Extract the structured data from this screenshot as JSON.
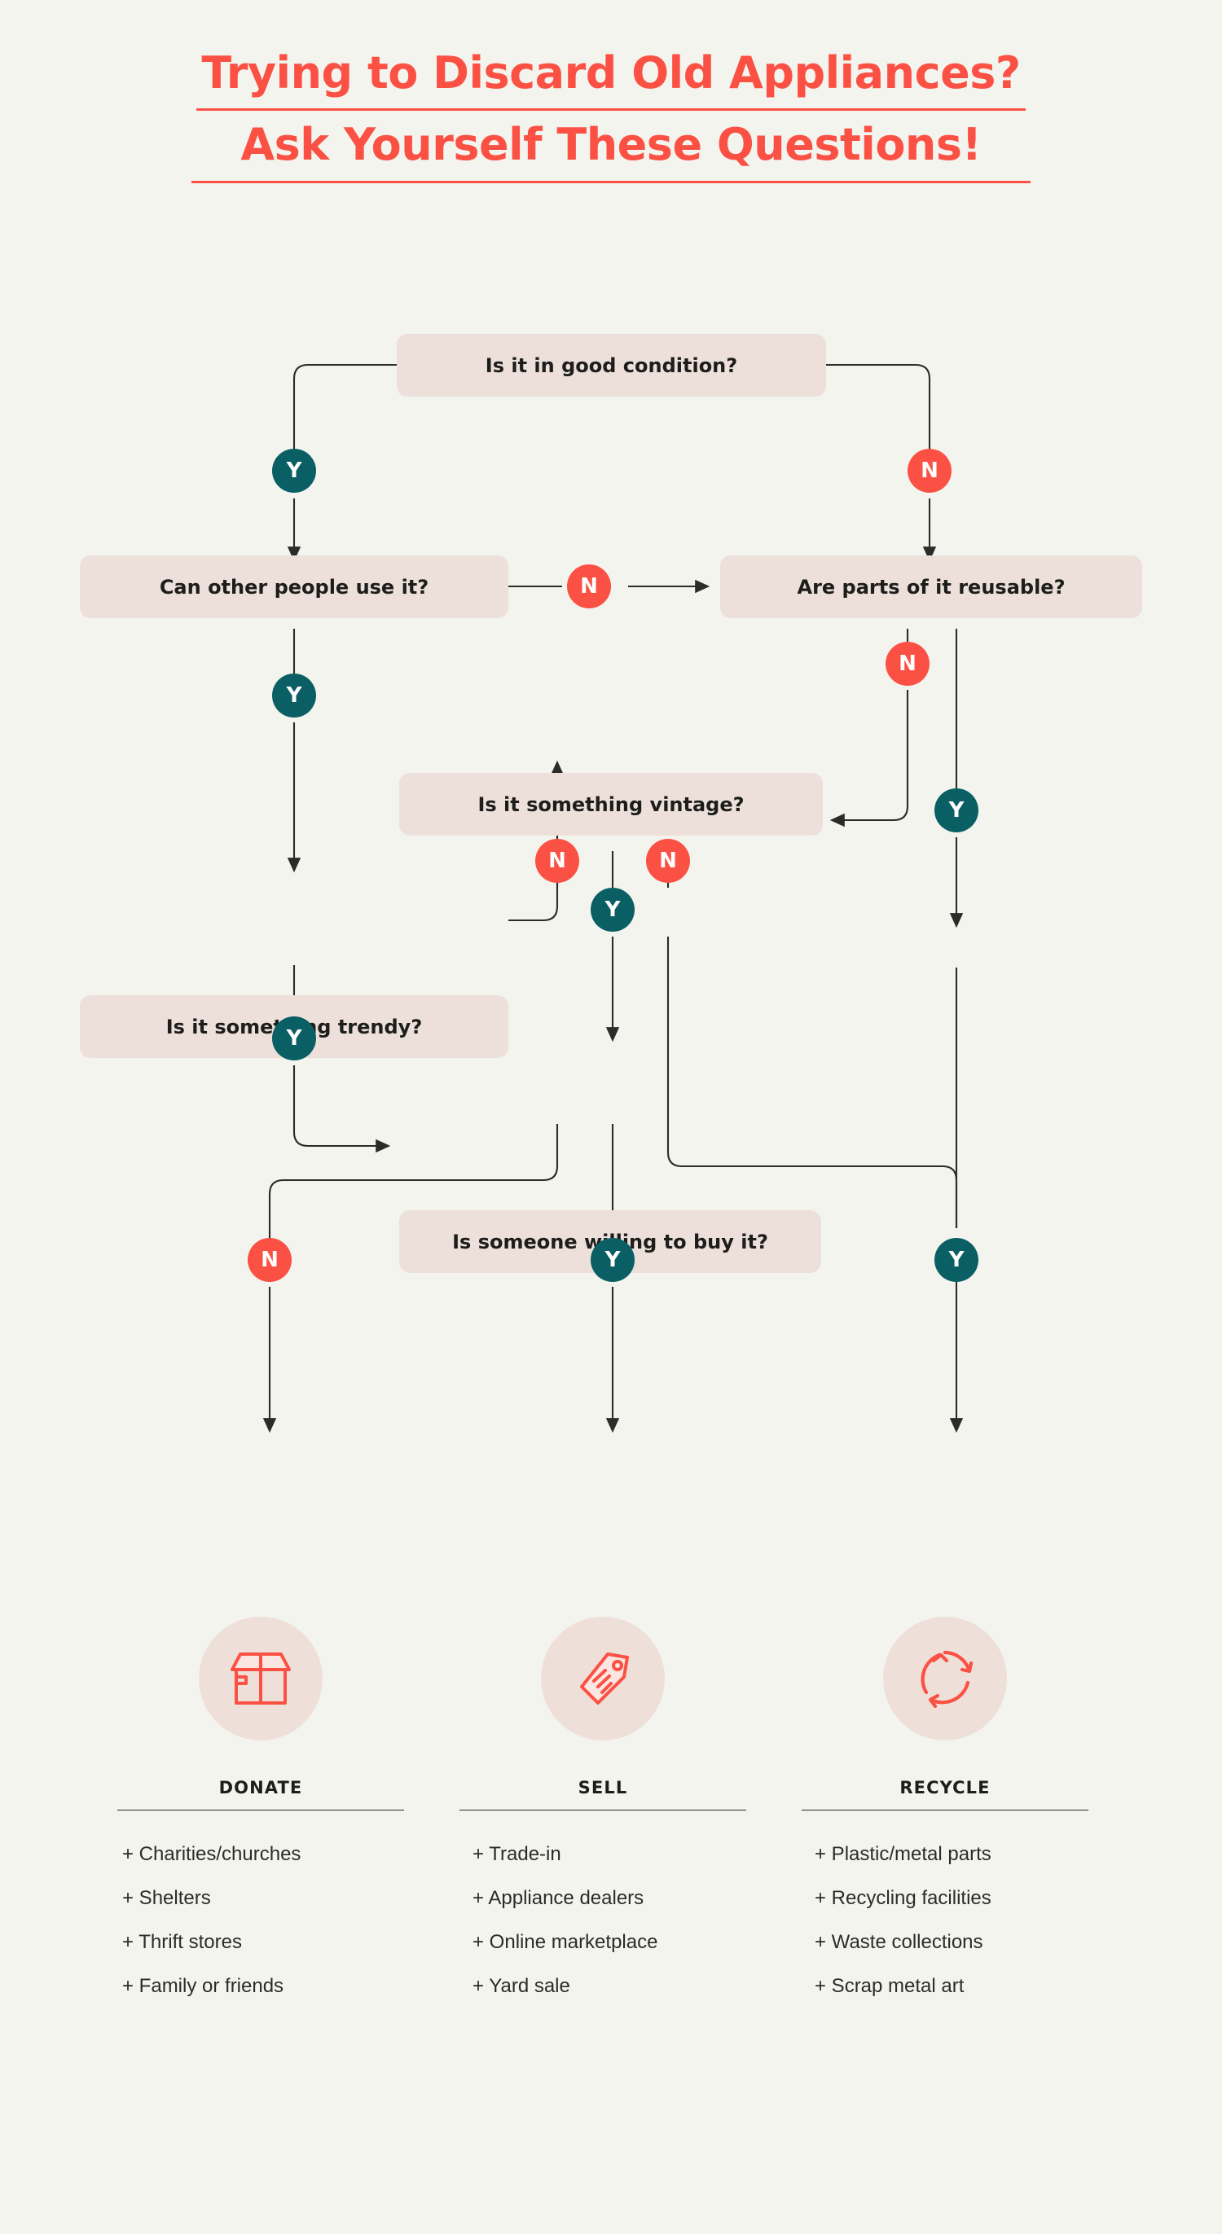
{
  "header": {
    "title_line1": "Trying to Discard Old Appliances?",
    "title_line2": "Ask Yourself These Questions!"
  },
  "colors": {
    "background": "#f4f4ef",
    "accent_red": "#fb5144",
    "accent_teal": "#0a5f64",
    "node_fill": "#ede0da",
    "line": "#2b2b29",
    "text": "#1d1d1b"
  },
  "flowchart": {
    "nodes": [
      {
        "id": "condition",
        "label": "Is it in good condition?"
      },
      {
        "id": "others-use",
        "label": "Can other people use it?"
      },
      {
        "id": "parts-reusable",
        "label": "Are parts of it reusable?"
      },
      {
        "id": "vintage",
        "label": "Is it something vintage?"
      },
      {
        "id": "trendy",
        "label": "Is it something trendy?"
      },
      {
        "id": "willing-buy",
        "label": "Is someone willing to buy it?"
      }
    ],
    "badges": [
      {
        "id": "b1",
        "value": "Y",
        "type": "yes"
      },
      {
        "id": "b2",
        "value": "N",
        "type": "no"
      },
      {
        "id": "b3",
        "value": "N",
        "type": "no"
      },
      {
        "id": "b4",
        "value": "N",
        "type": "no"
      },
      {
        "id": "b5",
        "value": "Y",
        "type": "yes"
      },
      {
        "id": "b6",
        "value": "N",
        "type": "no"
      },
      {
        "id": "b7",
        "value": "N",
        "type": "no"
      },
      {
        "id": "b8",
        "value": "Y",
        "type": "yes"
      },
      {
        "id": "b9",
        "value": "Y",
        "type": "yes"
      },
      {
        "id": "b10",
        "value": "Y",
        "type": "yes"
      },
      {
        "id": "b11",
        "value": "N",
        "type": "no"
      },
      {
        "id": "b12",
        "value": "Y",
        "type": "yes"
      },
      {
        "id": "b13",
        "value": "Y",
        "type": "yes"
      }
    ]
  },
  "outcomes": [
    {
      "id": "donate",
      "icon": "open-box-icon",
      "label": "DONATE",
      "items": [
        "+ Charities/churches",
        "+ Shelters",
        "+ Thrift stores",
        "+ Family or friends"
      ]
    },
    {
      "id": "sell",
      "icon": "price-tag-icon",
      "label": "SELL",
      "items": [
        "+ Trade-in",
        "+ Appliance dealers",
        "+ Online marketplace",
        "+ Yard sale"
      ]
    },
    {
      "id": "recycle",
      "icon": "recycle-arrows-icon",
      "label": "RECYCLE",
      "items": [
        "+ Plastic/metal parts",
        "+ Recycling facilities",
        "+ Waste collections",
        "+ Scrap metal art"
      ]
    }
  ]
}
